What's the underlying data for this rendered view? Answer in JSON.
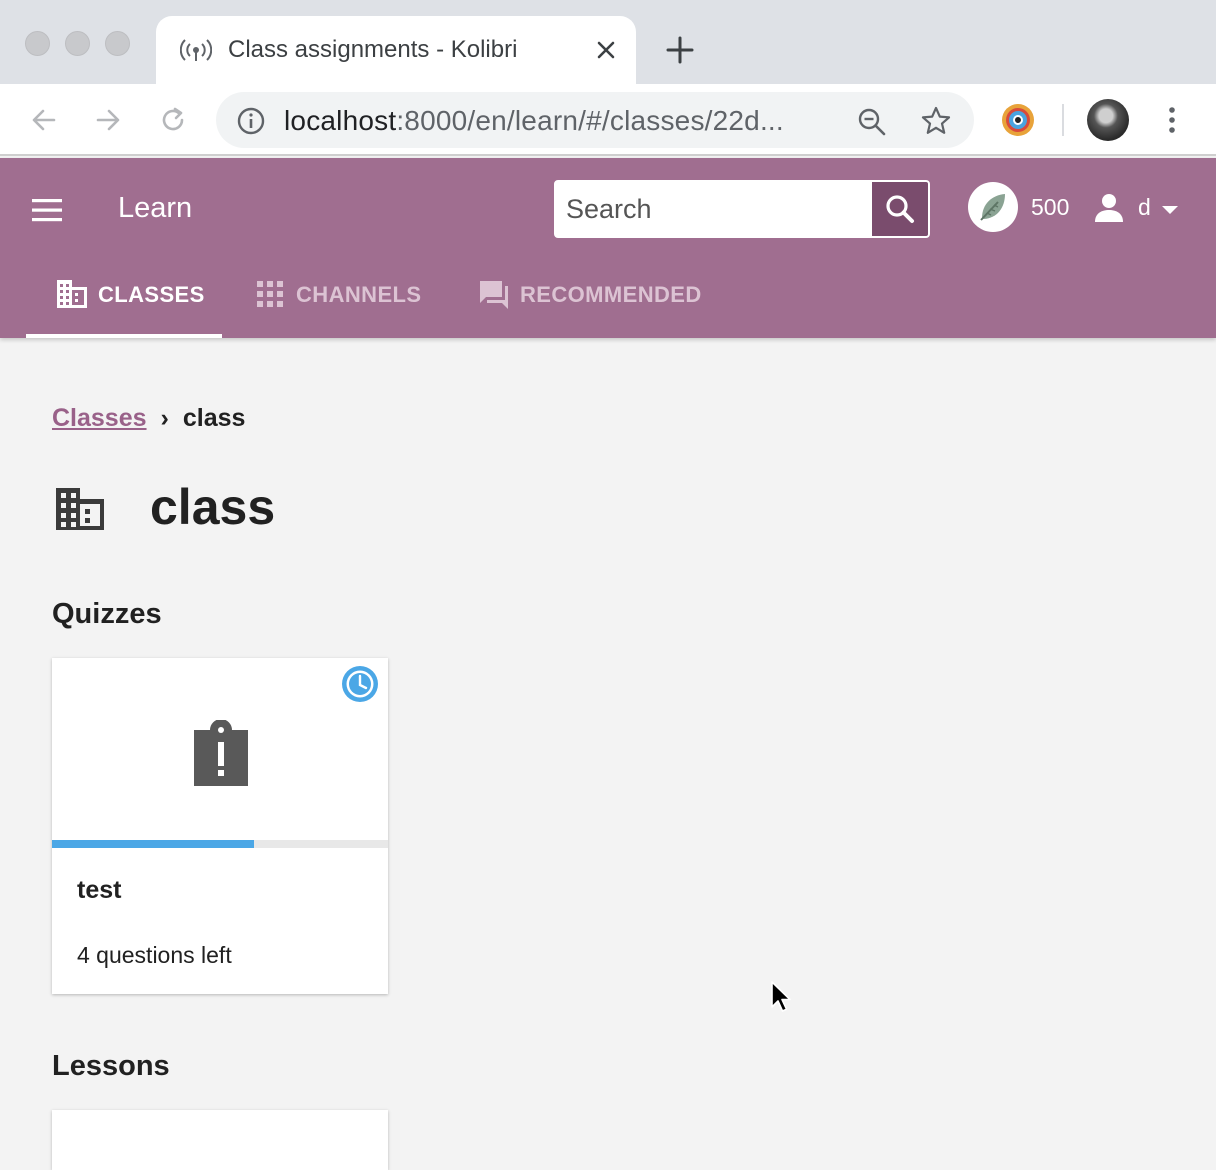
{
  "browser": {
    "tab_title": "Class assignments - Kolibri",
    "url_host": "localhost",
    "url_rest": ":8000/en/learn/#/classes/22d..."
  },
  "app": {
    "title": "Learn",
    "search_placeholder": "Search",
    "points": "500",
    "username": "d",
    "tabs": [
      {
        "label": "CLASSES",
        "icon": "classes-icon",
        "active": true
      },
      {
        "label": "CHANNELS",
        "icon": "channels-icon",
        "active": false
      },
      {
        "label": "RECOMMENDED",
        "icon": "recommended-icon",
        "active": false
      }
    ],
    "brand_color": "#a06e90",
    "active_underline_color": "#ffffff"
  },
  "page": {
    "breadcrumb": {
      "link": "Classes",
      "separator": "›",
      "current": "class"
    },
    "title": "class",
    "quizzes_heading": "Quizzes",
    "lessons_heading": "Lessons"
  },
  "quizzes": [
    {
      "title": "test",
      "subtitle": "4 questions left",
      "status_icon": "clock-icon",
      "progress": 0.6,
      "progress_color": "#4ba7e6"
    }
  ]
}
